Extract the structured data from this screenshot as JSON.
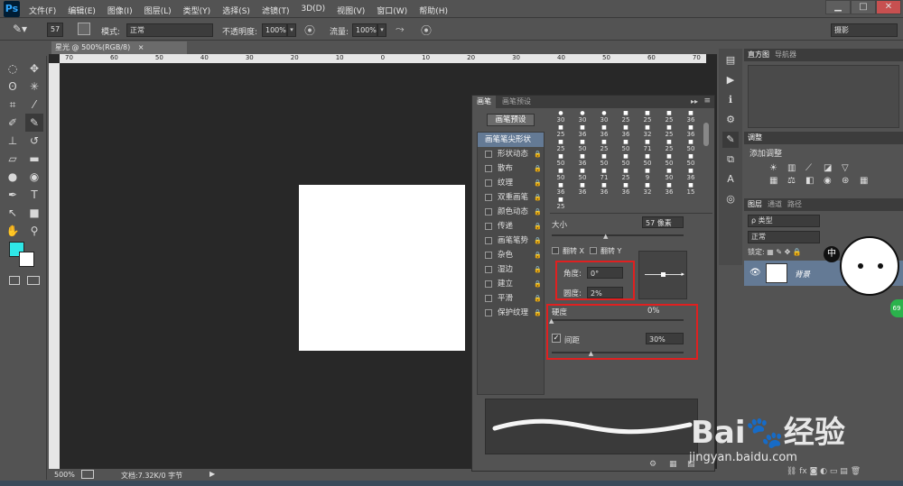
{
  "app": {
    "logo": "Ps"
  },
  "menu": [
    "文件(F)",
    "编辑(E)",
    "图像(I)",
    "图层(L)",
    "类型(Y)",
    "选择(S)",
    "滤镜(T)",
    "3D(D)",
    "视图(V)",
    "窗口(W)",
    "帮助(H)"
  ],
  "window_controls": [
    "▁",
    "□",
    "✕"
  ],
  "options": {
    "brush_size": "57",
    "mode_label": "模式:",
    "mode_value": "正常",
    "opacity_label": "不透明度:",
    "opacity_value": "100%",
    "flow_label": "流量:",
    "flow_value": "100%",
    "workspace": "摄影"
  },
  "document": {
    "tab_title": "星光 @ 500%(RGB/8)",
    "ruler_ticks": [
      "70",
      "60",
      "50",
      "40",
      "30",
      "20",
      "10",
      "0",
      "10",
      "20",
      "30",
      "40",
      "50",
      "60",
      "70"
    ],
    "zoom": "500%",
    "doc_info": "文档:7.32K/0 字节"
  },
  "brush_panel": {
    "tabs": [
      "画笔",
      "画笔预设"
    ],
    "preset_button": "画笔预设",
    "selected_item": "画笔笔尖形状",
    "items": [
      "形状动态",
      "散布",
      "纹理",
      "双重画笔",
      "颜色动态",
      "传递",
      "画笔笔势",
      "杂色",
      "湿边",
      "建立",
      "平滑",
      "保护纹理"
    ],
    "tip_numbers": [
      "30",
      "30",
      "30",
      "25",
      "25",
      "25",
      "36",
      "25",
      "36",
      "36",
      "36",
      "32",
      "25",
      "36",
      "25",
      "50",
      "25",
      "50",
      "71",
      "25",
      "50",
      "50",
      "36",
      "50",
      "50",
      "50",
      "50",
      "50",
      "50",
      "50",
      "71",
      "25",
      "9",
      "50",
      "36",
      "36",
      "36",
      "36",
      "36",
      "32",
      "36",
      "15",
      "25"
    ],
    "size_label": "大小",
    "size_value": "57 像素",
    "flip_x": "翻转 X",
    "flip_y": "翻转 Y",
    "angle_label": "角度:",
    "angle_value": "0°",
    "roundness_label": "圆度:",
    "roundness_value": "2%",
    "hardness_label": "硬度",
    "hardness_value": "0%",
    "spacing_label": "间距",
    "spacing_value": "30%",
    "hardness_level": 0,
    "spacing_level": 0.3
  },
  "right_panels": {
    "top_tabs": [
      "直方图",
      "导航器"
    ],
    "adjust_tab": "调整",
    "adjust_title": "添加调整",
    "layer_tabs": [
      "图层",
      "通道",
      "路径"
    ],
    "kind_label": "ρ 类型",
    "blend_mode": "正常",
    "lock_label": "锁定:",
    "layer_name": "背景",
    "badge": "69",
    "char_zh": "中"
  },
  "watermark": {
    "brand_a": "Bai",
    "brand_b": "经验",
    "url": "jingyan.baidu.com"
  },
  "colors": {
    "foreground": "#2fe6e6",
    "background": "#ffffff",
    "highlight": "#e02020"
  }
}
